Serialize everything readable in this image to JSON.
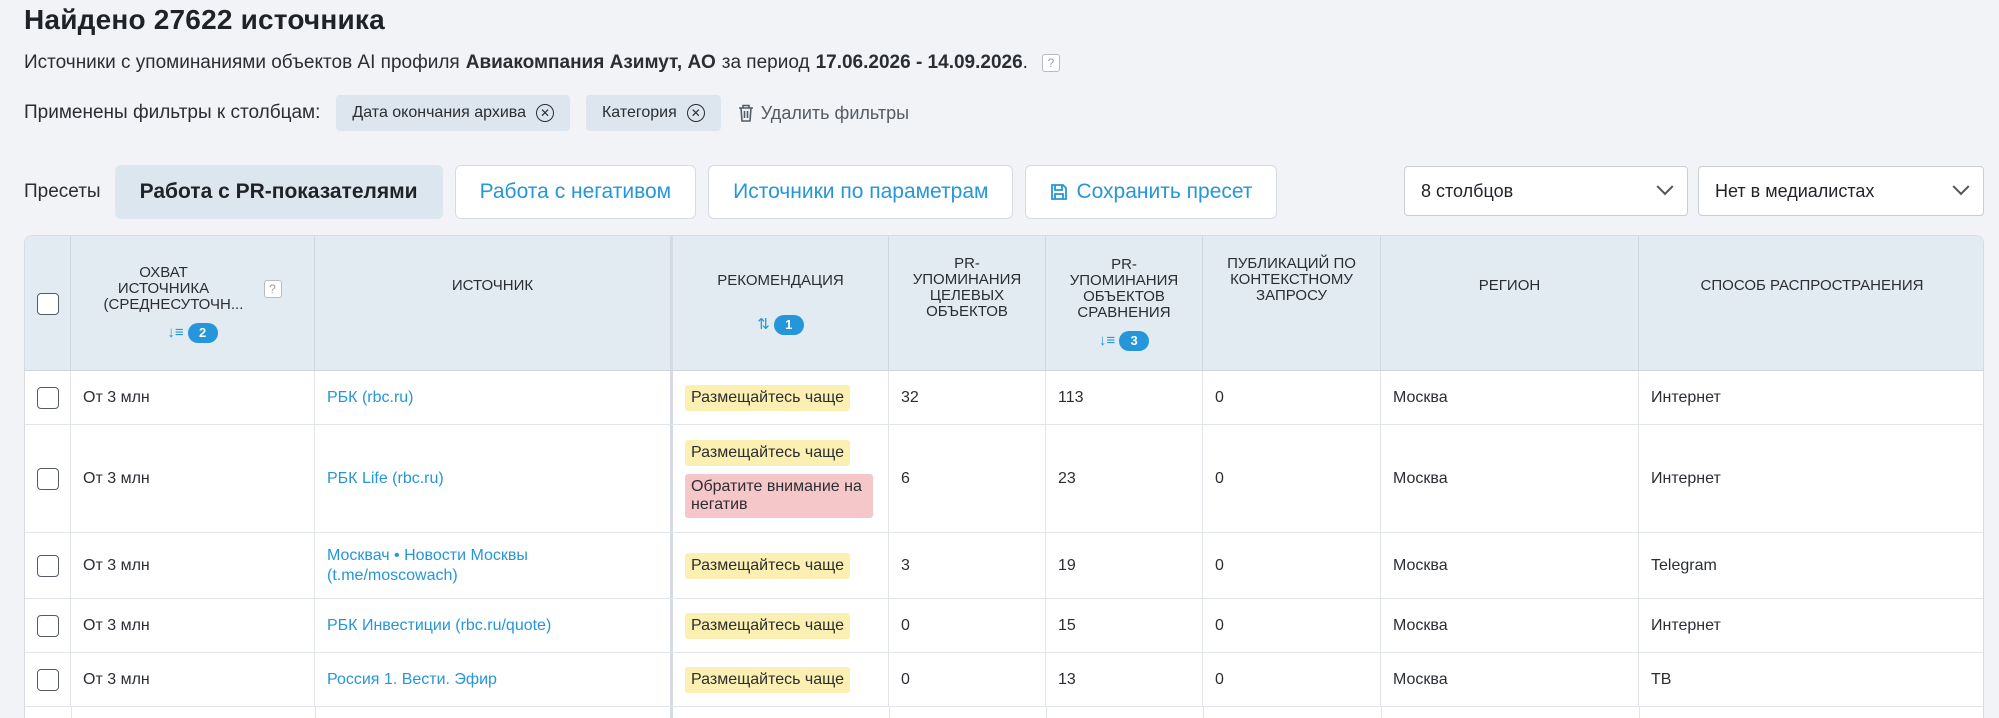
{
  "header": {
    "title": "Найдено 27622 источника",
    "subtitle_pre": "Источники с упоминаниями объектов AI профиля",
    "subtitle_company": "Авиакомпания Азимут, АО",
    "subtitle_mid": "за период",
    "subtitle_period": "17.06.2026 - 14.09.2026",
    "subtitle_end": ".",
    "help": "?"
  },
  "filters": {
    "label": "Применены фильтры к столбцам:",
    "chips": [
      "Дата окончания архива",
      "Категория"
    ],
    "delete_label": "Удалить фильтры"
  },
  "presets": {
    "label": "Пресеты",
    "items": [
      "Работа с PR-показателями",
      "Работа с негативом",
      "Источники по параметрам"
    ],
    "save_label": "Сохранить пресет"
  },
  "selects": {
    "columns": "8 столбцов",
    "medialists": "Нет в медиалистах"
  },
  "table": {
    "headers": {
      "reach": "Охват источника (среднесуточн...",
      "reach_sort": "2",
      "source": "Источник",
      "recommendation": "Рекомендация",
      "rec_sort": "1",
      "pr_target": "PR-упоминания целевых объектов",
      "pr_compare": "PR-упоминания объектов сравнения",
      "pr_compare_sort": "3",
      "pubs": "Публикаций по контекстному запросу",
      "region": "Регион",
      "distribution": "Способ распространения"
    },
    "rows": [
      {
        "reach": "От 3 млн",
        "source": "РБК (rbc.ru)",
        "rec1": "Размещайтесь чаще",
        "rec2": "",
        "pr_target": "32",
        "pr_compare": "113",
        "pubs": "0",
        "region": "Москва",
        "distribution": "Интернет"
      },
      {
        "reach": "От 3 млн",
        "source": "РБК Life (rbc.ru)",
        "rec1": "Размещайтесь чаще",
        "rec2": "Обратите внимание на негатив",
        "pr_target": "6",
        "pr_compare": "23",
        "pubs": "0",
        "region": "Москва",
        "distribution": "Интернет"
      },
      {
        "reach": "От 3 млн",
        "source": "Москвач • Новости Москвы (t.me/moscowach)",
        "rec1": "Размещайтесь чаще",
        "rec2": "",
        "pr_target": "3",
        "pr_compare": "19",
        "pubs": "0",
        "region": "Москва",
        "distribution": "Telegram"
      },
      {
        "reach": "От 3 млн",
        "source": "РБК Инвестиции (rbc.ru/quote)",
        "rec1": "Размещайтесь чаще",
        "rec2": "",
        "pr_target": "0",
        "pr_compare": "15",
        "pubs": "0",
        "region": "Москва",
        "distribution": "Интернет"
      },
      {
        "reach": "От 3 млн",
        "source": "Россия 1. Вести. Эфир",
        "rec1": "Размещайтесь чаще",
        "rec2": "",
        "pr_target": "0",
        "pr_compare": "13",
        "pubs": "0",
        "region": "Москва",
        "distribution": "ТВ"
      }
    ]
  }
}
